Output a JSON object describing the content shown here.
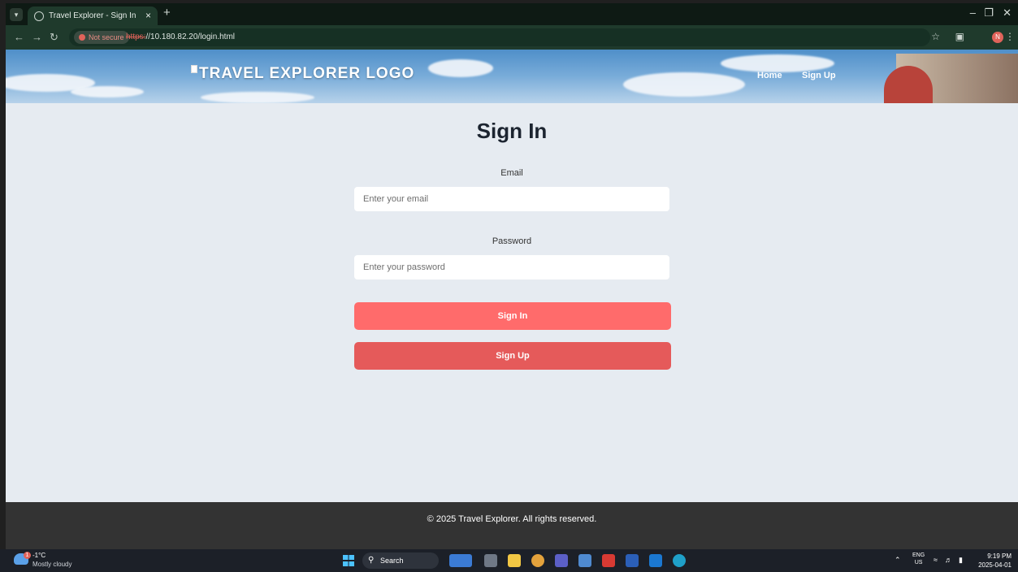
{
  "browser": {
    "tab_title": "Travel Explorer - Sign In",
    "tab_close": "×",
    "new_tab": "+",
    "security_label": "Not secure",
    "url_scheme": "https:",
    "url_rest": "//10.180.82.20/login.html",
    "profile_initial": "N"
  },
  "header": {
    "logo_text": "TRAVEL EXPLORER LOGO",
    "nav": [
      "Home",
      "Sign Up"
    ]
  },
  "form": {
    "title": "Sign In",
    "email_label": "Email",
    "email_placeholder": "Enter your email",
    "password_label": "Password",
    "password_placeholder": "Enter your password",
    "signin_label": "Sign In",
    "signup_label": "Sign Up"
  },
  "footer": {
    "copyright": "© 2025 Travel Explorer. All rights reserved."
  },
  "taskbar": {
    "weather_temp": "-1°C",
    "weather_desc": "Mostly cloudy",
    "weather_badge": "1",
    "search_label": "Search",
    "lang_top": "ENG",
    "lang_bottom": "US",
    "time": "9:19 PM",
    "date": "2025-04-01"
  },
  "colors": {
    "signin_button": "#ff6b6b",
    "signup_button": "#e55a5a",
    "footer_bg": "#333333",
    "page_bg": "#e6ebf1"
  }
}
